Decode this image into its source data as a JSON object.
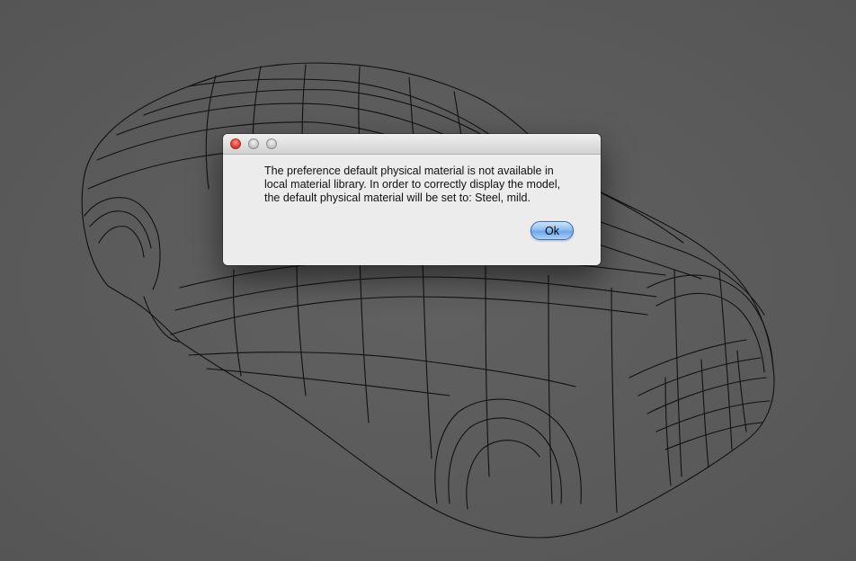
{
  "viewport": {
    "background_color": "#5b5b5b",
    "model_stroke_color": "#111111"
  },
  "dialog": {
    "titlebar": {
      "buttons": [
        {
          "name": "close",
          "icon": "close-icon",
          "color": "#e0443a"
        },
        {
          "name": "minimize",
          "icon": "minimize-icon",
          "color": "#c8c8c8"
        },
        {
          "name": "zoom",
          "icon": "zoom-icon",
          "color": "#c8c8c8"
        }
      ]
    },
    "message_lines": [
      "The preference default physical material is not available in",
      "local material library. In order to correctly display the model,",
      "the default physical material will be set to: Steel, mild."
    ],
    "ok_label": "Ok",
    "ok_button_color": "#6ea8ea"
  }
}
